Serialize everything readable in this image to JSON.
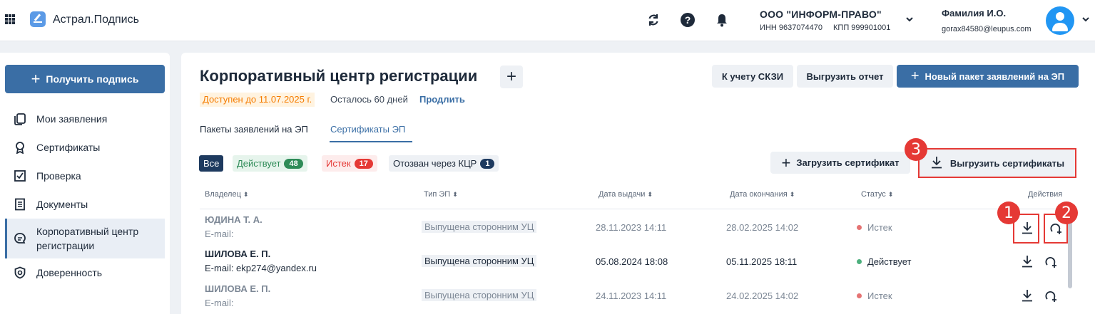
{
  "header": {
    "app_title": "Астрал.Подпись",
    "org_name": "ООО \"ИНФОРМ-ПРАВО\"",
    "org_inn": "ИНН 9637074470",
    "org_kpp": "КПП 999901001",
    "user_name": "Фамилия И.О.",
    "user_email": "gorax84580@leupus.com"
  },
  "sidebar": {
    "primary_button": "Получить подпись",
    "items": [
      {
        "label": "Мои заявления",
        "icon": "copy-icon"
      },
      {
        "label": "Сертификаты",
        "icon": "award-icon"
      },
      {
        "label": "Проверка",
        "icon": "checkbox-icon"
      },
      {
        "label": "Документы",
        "icon": "document-icon"
      },
      {
        "label": "Корпоративный центр регистрации",
        "icon": "chat-icon"
      },
      {
        "label": "Доверенность",
        "icon": "shield-icon"
      }
    ]
  },
  "page": {
    "title": "Корпоративный центр регистрации",
    "buttons": {
      "skzi": "К учету СКЗИ",
      "report": "Выгрузить отчет",
      "new_package": "Новый пакет заявлений на ЭП"
    },
    "available_until": "Доступен до 11.07.2025 г.",
    "days_left": "Осталось 60 дней",
    "extend": "Продлить",
    "tabs": [
      "Пакеты заявлений на ЭП",
      "Сертификаты ЭП"
    ],
    "active_tab": "Сертификаты ЭП"
  },
  "filters": {
    "all": "Все",
    "active": "Действует",
    "active_count": "48",
    "expired": "Истек",
    "expired_count": "17",
    "revoked": "Отозван через КЦР",
    "revoked_count": "1"
  },
  "actions": {
    "upload": "Загрузить сертификат",
    "export": "Выгрузить сертификаты"
  },
  "table": {
    "columns": [
      "Владелец",
      "Тип ЭП",
      "Дата выдачи",
      "Дата окончания",
      "Статус",
      "Действия"
    ],
    "rows": [
      {
        "owner": "ЮДИНА Т. А.",
        "email": "E-mail:",
        "type": "Выпущена сторонним УЦ",
        "issued": "28.11.2023 14:11",
        "expires": "28.02.2025 14:02",
        "status": "Истек"
      },
      {
        "owner": "ШИЛОВА Е. П.",
        "email": "E-mail: ekp274@yandex.ru",
        "type": "Выпущена сторонним УЦ",
        "issued": "05.08.2024 18:08",
        "expires": "05.11.2025 18:11",
        "status": "Действует"
      },
      {
        "owner": "ШИЛОВА Е. П.",
        "email": "E-mail:",
        "type": "Выпущена сторонним УЦ",
        "issued": "24.11.2023 14:11",
        "expires": "24.02.2025 14:02",
        "status": "Истек"
      }
    ]
  },
  "annotations": [
    "1",
    "2",
    "3"
  ],
  "colors": {
    "primary": "#3a6ea5",
    "status_active": "#2e8b57",
    "status_expired": "#e53935",
    "highlight": "#e53935"
  }
}
